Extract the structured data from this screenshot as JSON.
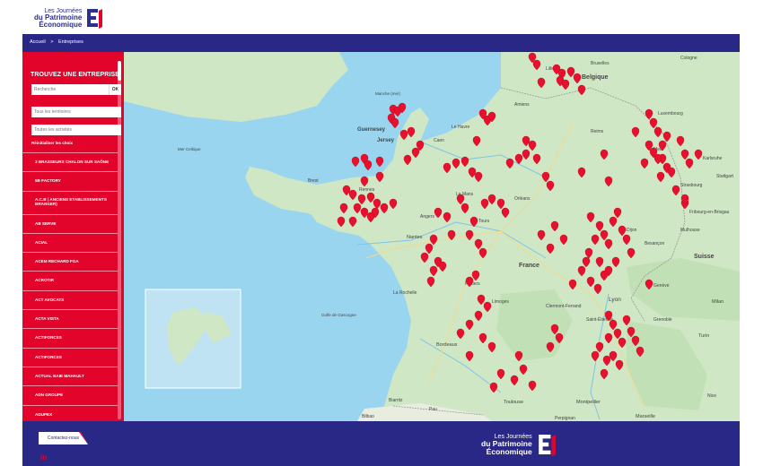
{
  "header": {
    "logo": {
      "line1": "Les Journées",
      "line2": "du Patrimoine",
      "line3": "Économique",
      "mark_color": "#2b2f8f",
      "accent": "#e3042b"
    }
  },
  "breadcrumb": {
    "home": "Accueil",
    "separator": ">",
    "current": "Entreprises"
  },
  "sidebar": {
    "title": "TROUVEZ UNE ENTREPRISE",
    "search_placeholder": "Recherche",
    "ok_label": "OK",
    "territory_select": "Tous les territoires",
    "activity_select": "Toutes les activités",
    "reset_label": "Réinitialiser les choix",
    "companies": [
      "3 BRASSEURS CHALON SUR SAÔNE",
      "5B FACTORY",
      "A.C.B ( ANCIENS ETABLISSEMENTS BRANGER)",
      "AB SERVE",
      "ACIAL",
      "ACEM RECHARD FGA",
      "ACROTIR",
      "ACT AVOCATS",
      "ACTA VISTA",
      "ACTIFORCES",
      "ACTIFORCES",
      "ACTUAL BAIE MAHAULT",
      "ADN GROUPE",
      "ADUPEX"
    ]
  },
  "map": {
    "water_color": "#9ad5f0",
    "land_color": "#cfe7c4",
    "pin_color": "#e8112d",
    "labels": {
      "belgique": "Belgique",
      "bruxelles": "Bruxelles",
      "france": "France",
      "suisse": "Suisse",
      "guernesey": "Guernesey",
      "jersey": "Jersey",
      "nantes": "Nantes",
      "lyon": "Lyon",
      "bordeaux": "Bordeaux",
      "toulouse": "Toulouse",
      "marseille": "Marseille",
      "montpellier": "Montpellier",
      "turin": "Turin",
      "milan": "Milan",
      "limoges": "Limoges",
      "rennes": "Rennes",
      "brest": "Brest",
      "caen": "Caen",
      "le_havre": "Le Havre",
      "la_rochelle": "La Rochelle",
      "amiens": "Amiens",
      "lille": "Lille",
      "koln": "Cologne",
      "luxembourg": "Luxembourg",
      "strasbourg": "Strasbourg",
      "dijon": "Dijon",
      "geneve": "Genève",
      "grenoble": "Grenoble",
      "nice": "Nice",
      "bilbao": "Bilbao",
      "golfe": "Golfe de Gascogne",
      "manche": "Manche (mer)",
      "mer_celtique": "Mer Celtique",
      "poitiers": "Poitiers",
      "angers": "Angers",
      "le_mans": "Le Mans",
      "orleans": "Orléans",
      "tours": "Tours",
      "clermont": "Clermont-Ferrand",
      "saint_etienne": "Saint-Étienne",
      "reims": "Reims",
      "metz": "Metz",
      "mulhouse": "Mulhouse",
      "besancon": "Besançon",
      "fribourg": "Fribourg-en-Brisgau",
      "karlsruhe": "Karlsruhe",
      "stuttgart": "Stuttgart",
      "biarritz": "Biarritz",
      "pau": "Pau",
      "perpignan": "Perpignan"
    }
  },
  "footer": {
    "contact_label": "Contactez-nous",
    "linkedin_label": "in",
    "logo": {
      "line1": "Les Journées",
      "line2": "du Patrimoine",
      "line3": "Économique"
    }
  }
}
